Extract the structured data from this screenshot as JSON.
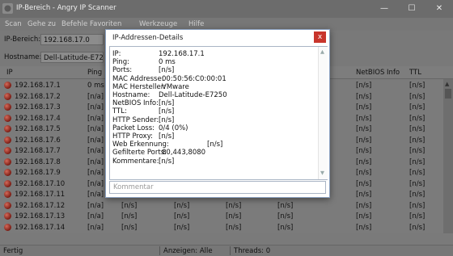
{
  "window": {
    "title": "IP-Bereich - Angry IP Scanner",
    "controls": [
      "—",
      "☐",
      "✕"
    ]
  },
  "menu": [
    "Scan",
    "Gehe zu",
    "Befehle",
    "Favoriten",
    "Werkzeuge",
    "Hilfe"
  ],
  "toolbar": {
    "range_label": "IP-Bereich:",
    "range_start": "192.168.17.0",
    "hostname_label": "Hostname:",
    "hostname_value": "Dell-Latitude-E7250"
  },
  "table": {
    "headers": [
      "IP",
      "Ping",
      "NetBIOS Info",
      "TTL"
    ],
    "rows": [
      {
        "ip": "192.168.17.1",
        "cells": [
          "0 ms",
          "",
          "",
          "",
          "",
          "[n/s]",
          "[n/s]"
        ]
      },
      {
        "ip": "192.168.17.2",
        "cells": [
          "[n/a]",
          "",
          "",
          "",
          "",
          "[n/s]",
          "[n/s]"
        ]
      },
      {
        "ip": "192.168.17.3",
        "cells": [
          "[n/a]",
          "",
          "",
          "",
          "",
          "[n/s]",
          "[n/s]"
        ]
      },
      {
        "ip": "192.168.17.4",
        "cells": [
          "[n/a]",
          "",
          "",
          "",
          "",
          "[n/s]",
          "[n/s]"
        ]
      },
      {
        "ip": "192.168.17.5",
        "cells": [
          "[n/a]",
          "",
          "",
          "",
          "",
          "[n/s]",
          "[n/s]"
        ]
      },
      {
        "ip": "192.168.17.6",
        "cells": [
          "[n/a]",
          "",
          "",
          "",
          "",
          "[n/s]",
          "[n/s]"
        ]
      },
      {
        "ip": "192.168.17.7",
        "cells": [
          "[n/a]",
          "",
          "",
          "",
          "",
          "[n/s]",
          "[n/s]"
        ]
      },
      {
        "ip": "192.168.17.8",
        "cells": [
          "[n/a]",
          "",
          "",
          "",
          "",
          "[n/s]",
          "[n/s]"
        ]
      },
      {
        "ip": "192.168.17.9",
        "cells": [
          "[n/a]",
          "",
          "",
          "",
          "",
          "[n/s]",
          "[n/s]"
        ]
      },
      {
        "ip": "192.168.17.10",
        "cells": [
          "[n/a]",
          "",
          "",
          "",
          "",
          "[n/s]",
          "[n/s]"
        ]
      },
      {
        "ip": "192.168.17.11",
        "cells": [
          "[n/a]",
          "[n/s]",
          "[n/s]",
          "[n/s]",
          "[n/s]",
          "[n/s]",
          "[n/s]"
        ]
      },
      {
        "ip": "192.168.17.12",
        "cells": [
          "[n/a]",
          "[n/s]",
          "[n/s]",
          "[n/s]",
          "[n/s]",
          "[n/s]",
          "[n/s]"
        ]
      },
      {
        "ip": "192.168.17.13",
        "cells": [
          "[n/a]",
          "[n/s]",
          "[n/s]",
          "[n/s]",
          "[n/s]",
          "[n/s]",
          "[n/s]"
        ]
      },
      {
        "ip": "192.168.17.14",
        "cells": [
          "[n/a]",
          "[n/s]",
          "[n/s]",
          "[n/s]",
          "[n/s]",
          "[n/s]",
          "[n/s]"
        ]
      }
    ]
  },
  "status": {
    "left": "Fertig",
    "display": "Anzeigen: Alle",
    "threads": "Threads: 0"
  },
  "dialog": {
    "title": "IP-Addressen-Details",
    "close": "x",
    "details": [
      {
        "label": "IP:",
        "value": "192.168.17.1"
      },
      {
        "label": "Ping:",
        "value": "0 ms"
      },
      {
        "label": "Ports:",
        "value": "[n/s]"
      },
      {
        "label": "MAC Addresse:",
        "value": "00:50:56:C0:00:01"
      },
      {
        "label": "MAC Hersteller:",
        "value": "VMware"
      },
      {
        "label": "Hostname:",
        "value": "Dell-Latitude-E7250"
      },
      {
        "label": "NetBIOS Info:",
        "value": "[n/s]"
      },
      {
        "label": "TTL:",
        "value": "[n/s]"
      },
      {
        "label": "HTTP Sender:",
        "value": "[n/s]"
      },
      {
        "label": "Packet Loss:",
        "value": "0/4 (0%)"
      },
      {
        "label": "HTTP Proxy:",
        "value": "[n/s]"
      },
      {
        "label": "Web Erkennung:",
        "value": "[n/s]"
      },
      {
        "label": "Gefilterte Ports:",
        "value": "80,443,8080"
      },
      {
        "label": "Kommentare:",
        "value": "[n/s]"
      }
    ],
    "comment_placeholder": "Kommentar"
  },
  "colors": {
    "dialog_close": "#c8352c",
    "status_dot": "#a8382a"
  }
}
